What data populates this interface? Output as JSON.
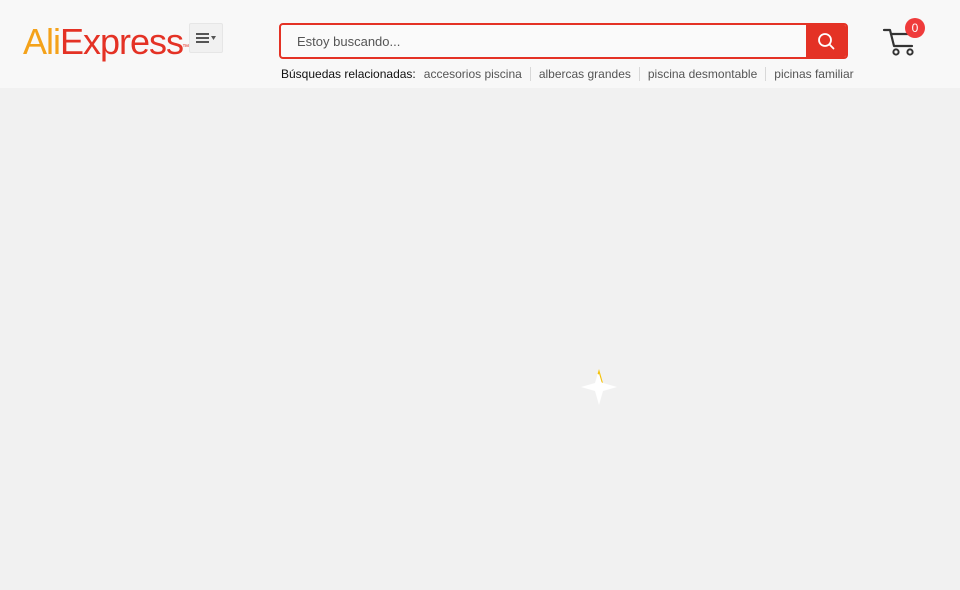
{
  "header": {
    "logo": {
      "part1": "Ali",
      "part2": "Express",
      "tm": "™"
    },
    "menu": {
      "icon": "hamburger-dropdown-icon"
    },
    "search": {
      "placeholder": "Estoy buscando...",
      "value": "",
      "button_icon": "search-icon"
    },
    "related": {
      "label": "Búsquedas relacionadas:",
      "items": [
        {
          "label": "accesorios piscina"
        },
        {
          "label": "albercas grandes"
        },
        {
          "label": "piscina desmontable"
        },
        {
          "label": "picinas familiar"
        }
      ]
    },
    "cart": {
      "icon": "cart-icon",
      "count": "0"
    }
  },
  "content": {
    "loading_icon": "loading-spinner-icon"
  },
  "colors": {
    "brand_orange": "#f4a21a",
    "brand_red": "#e43225",
    "badge_red": "#ef3b3b",
    "header_bg": "#f8f8f8",
    "content_bg": "#f1f1f1"
  }
}
